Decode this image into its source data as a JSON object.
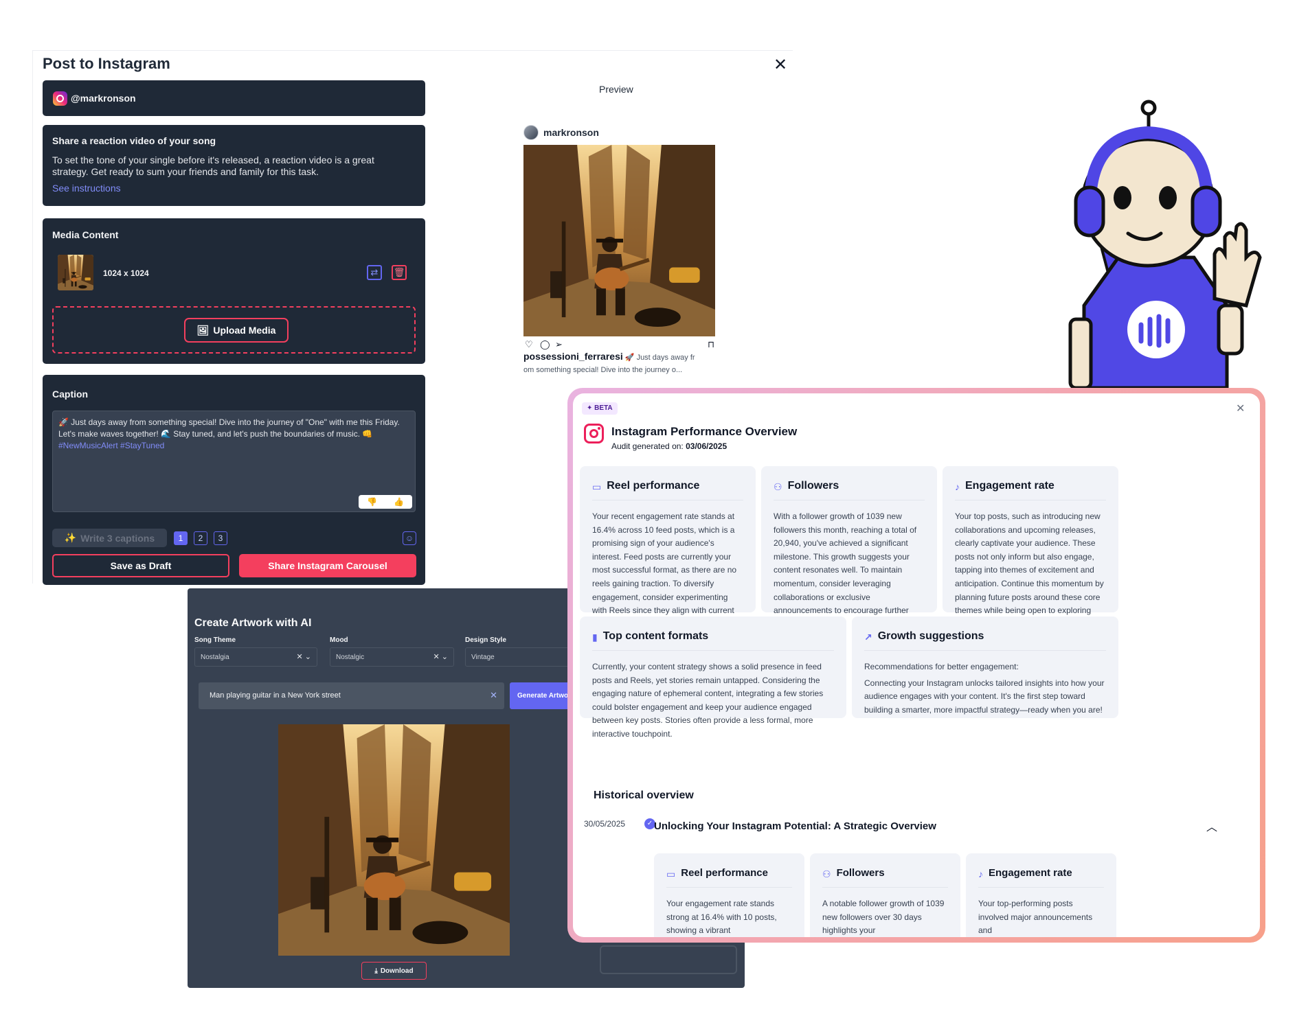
{
  "post_dialog": {
    "title": "Post to Instagram",
    "account": "@markronson",
    "task": {
      "title": "Share a reaction video of your song",
      "text": "To set the tone of your single before it's released, a reaction video is a great strategy. Get ready to sum your friends and family for this task.",
      "link": "See instructions"
    },
    "media": {
      "title": "Media Content",
      "size": "1024 x 1024",
      "upload_label": "Upload Media"
    },
    "caption": {
      "title": "Caption",
      "text": "🚀 Just days away from something special! Dive into the journey of \"One\" with me this Friday. Let's make waves together! 🌊 Stay tuned, and let's push the boundaries of music. 👊",
      "hashtags": "#NewMusicAlert #StayTuned",
      "write_label": "Write 3 captions",
      "pages": [
        "1",
        "2",
        "3"
      ]
    },
    "save_draft_label": "Save as Draft",
    "share_label": "Share Instagram Carousel"
  },
  "preview": {
    "label": "Preview",
    "username": "markronson",
    "caption_user": "possessioni_ferraresi",
    "caption_line1": "🚀 Just days away fr",
    "caption_line2": "om something special! Dive into the journey o..."
  },
  "artwork": {
    "title": "Create Artwork with AI",
    "fields": [
      {
        "label": "Song Theme",
        "value": "Nostalgia"
      },
      {
        "label": "Mood",
        "value": "Nostalgic"
      },
      {
        "label": "Design Style",
        "value": "Vintage"
      }
    ],
    "prompt": "Man playing guitar in a New York street",
    "generate_label": "Generate Artwork",
    "download_label": "Download"
  },
  "performance": {
    "badge": "BETA",
    "title": "Instagram Performance Overview",
    "audit_label": "Audit generated on:",
    "audit_date": "03/06/2025",
    "cards": {
      "reel": {
        "title": "Reel performance",
        "body": "Your recent engagement rate stands at 16.4% across 10 feed posts, which is a promising sign of your audience's interest. Feed posts are currently your most successful format, as there are no reels gaining traction. To diversify engagement, consider experimenting with Reels since they align with current platform trends and can boost your visibility through their discoverability."
      },
      "followers": {
        "title": "Followers",
        "body": "With a follower growth of 1039 new followers this month, reaching a total of 20,940, you've achieved a significant milestone. This growth suggests your content resonates well. To maintain momentum, consider leveraging collaborations or exclusive announcements to encourage further growth."
      },
      "engagement": {
        "title": "Engagement rate",
        "body": "Your top posts, such as introducing new collaborations and upcoming releases, clearly captivate your audience. These posts not only inform but also engage, tapping into themes of excitement and anticipation. Continue this momentum by planning future posts around these core themes while being open to exploring new creative angles."
      },
      "formats": {
        "title": "Top content formats",
        "body": "Currently, your content strategy shows a solid presence in feed posts and Reels, yet stories remain untapped. Considering the engaging nature of ephemeral content, integrating a few stories could bolster engagement and keep your audience engaged between key posts. Stories often provide a less formal, more interactive touchpoint."
      },
      "growth": {
        "title": "Growth suggestions",
        "intro": "Recommendations for better engagement:",
        "body": "Connecting your Instagram unlocks tailored insights into how your audience engages with your content. It's the first step toward building a smarter, more impactful strategy—ready when you are!"
      }
    },
    "history": {
      "title": "Historical overview",
      "date": "30/05/2025",
      "heading": "Unlocking Your Instagram Potential: A Strategic Overview",
      "cards": [
        {
          "title": "Reel performance",
          "body": "Your engagement rate stands strong at 16.4% with 10 posts, showing a vibrant"
        },
        {
          "title": "Followers",
          "body": "A notable follower growth of 1039 new followers over 30 days highlights your"
        },
        {
          "title": "Engagement rate",
          "body": "Your top-performing posts involved major announcements and"
        }
      ]
    }
  },
  "colors": {
    "dark_card": "#1f2937",
    "accent_pink": "#f43f5e",
    "accent_indigo": "#6366f1",
    "artwork_bg": "#374151",
    "card_bg": "#f1f3f8"
  },
  "icons": [
    "instagram-icon",
    "close-icon",
    "replace-icon",
    "trash-icon",
    "upload-image-icon",
    "thumbs-down-icon",
    "thumbs-up-icon",
    "sparkle-icon",
    "emoji-icon",
    "heart-icon",
    "comment-icon",
    "send-icon",
    "bookmark-icon",
    "chevron-down-icon",
    "download-icon",
    "video-icon",
    "user-icon",
    "music-note-icon",
    "bar-chart-icon",
    "trend-up-icon",
    "check-circle-icon",
    "chevron-up-icon"
  ]
}
